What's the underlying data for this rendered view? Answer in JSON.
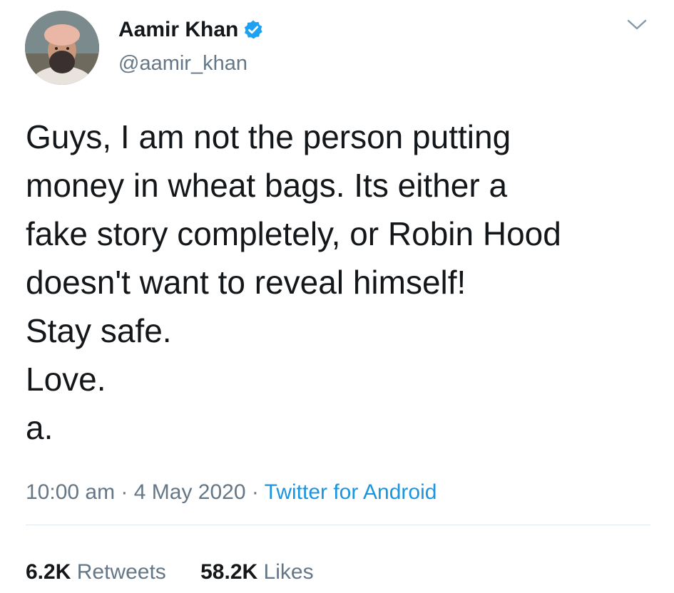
{
  "author": {
    "display_name": "Aamir Khan",
    "handle": "@aamir_khan",
    "verified": true
  },
  "tweet": {
    "lines": [
      "Guys, I am not the person putting",
      "money in wheat bags. Its either a",
      "fake story completely, or Robin Hood",
      "doesn't want to reveal himself!",
      "Stay safe.",
      "Love.",
      "a."
    ]
  },
  "meta": {
    "time": "10:00 am",
    "separator1": " · ",
    "date": "4 May 2020",
    "separator2": " · ",
    "source": "Twitter for Android"
  },
  "stats": {
    "retweets_count": "6.2K",
    "retweets_label": "Retweets",
    "likes_count": "58.2K",
    "likes_label": "Likes"
  },
  "icons": {
    "more": "chevron-down-icon",
    "verified": "verified-badge-icon"
  },
  "colors": {
    "text": "#14171a",
    "secondary": "#657786",
    "link": "#1b95e0",
    "verified": "#1da1f2",
    "divider": "#e1e8ed"
  }
}
